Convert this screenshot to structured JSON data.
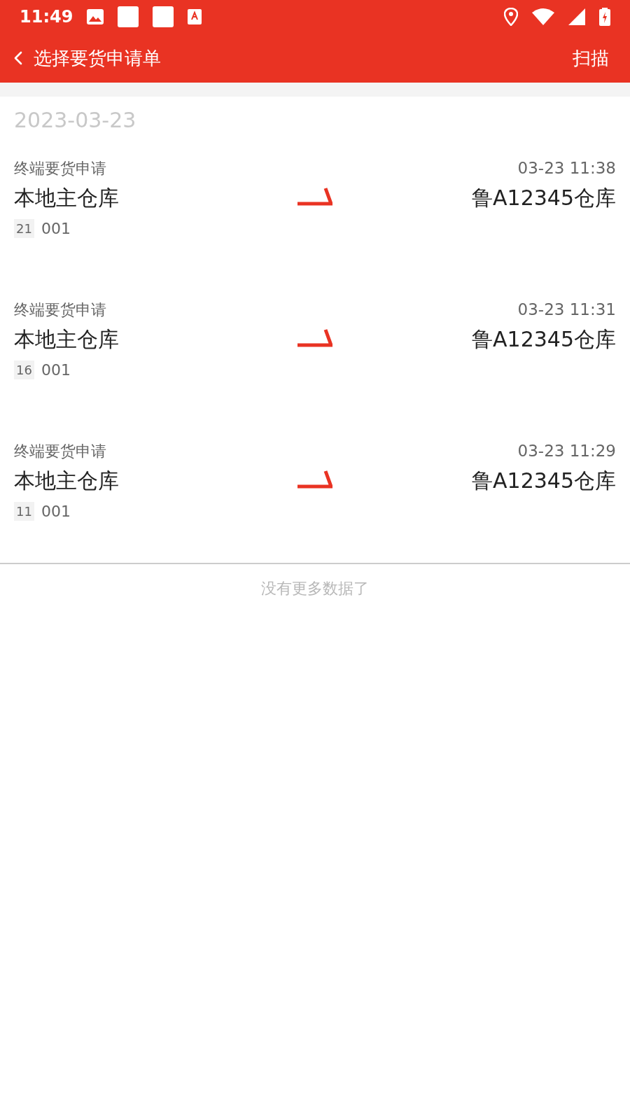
{
  "status_bar": {
    "time": "11:49"
  },
  "header": {
    "title": "选择要货申请单",
    "action": "扫描"
  },
  "date_group": "2023-03-23",
  "orders": [
    {
      "type": "终端要货申请",
      "time": "03-23 11:38",
      "from": "本地主仓库",
      "to": "鲁A12345仓库",
      "count": "21",
      "code": "001"
    },
    {
      "type": "终端要货申请",
      "time": "03-23 11:31",
      "from": "本地主仓库",
      "to": "鲁A12345仓库",
      "count": "16",
      "code": "001"
    },
    {
      "type": "终端要货申请",
      "time": "03-23 11:29",
      "from": "本地主仓库",
      "to": "鲁A12345仓库",
      "count": "11",
      "code": "001"
    }
  ],
  "footer": "没有更多数据了"
}
